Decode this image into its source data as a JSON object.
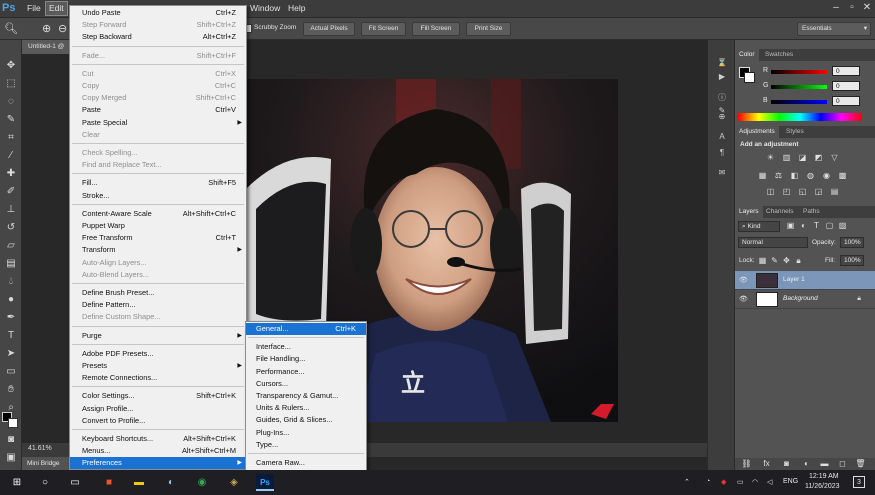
{
  "app": {
    "logo": "Ps",
    "document_tab": "Untitled-1 @",
    "zoom": "41.61%",
    "mini_bridge": "Mini Bridge"
  },
  "menubar": {
    "items": [
      "File",
      "Edit"
    ],
    "window": "Window",
    "help": "Help",
    "active": "Edit"
  },
  "options_bar": {
    "scrubby_zoom": "Scrubby Zoom",
    "actual_pixels": "Actual Pixels",
    "fit_screen": "Fit Screen",
    "fill_screen": "Fill Screen",
    "print_size": "Print Size",
    "workspace": "Essentials"
  },
  "edit_menu": [
    {
      "label": "Undo Paste",
      "shortcut": "Ctrl+Z",
      "enabled": true
    },
    {
      "label": "Step Forward",
      "shortcut": "Shift+Ctrl+Z",
      "enabled": false
    },
    {
      "label": "Step Backward",
      "shortcut": "Alt+Ctrl+Z",
      "enabled": true
    },
    {
      "sep": true
    },
    {
      "label": "Fade...",
      "shortcut": "Shift+Ctrl+F",
      "enabled": false
    },
    {
      "sep": true
    },
    {
      "label": "Cut",
      "shortcut": "Ctrl+X",
      "enabled": false
    },
    {
      "label": "Copy",
      "shortcut": "Ctrl+C",
      "enabled": false
    },
    {
      "label": "Copy Merged",
      "shortcut": "Shift+Ctrl+C",
      "enabled": false
    },
    {
      "label": "Paste",
      "shortcut": "Ctrl+V",
      "enabled": true
    },
    {
      "label": "Paste Special",
      "shortcut": "",
      "enabled": true,
      "submenu": true
    },
    {
      "label": "Clear",
      "shortcut": "",
      "enabled": false
    },
    {
      "sep": true
    },
    {
      "label": "Check Spelling...",
      "shortcut": "",
      "enabled": false
    },
    {
      "label": "Find and Replace Text...",
      "shortcut": "",
      "enabled": false
    },
    {
      "sep": true
    },
    {
      "label": "Fill...",
      "shortcut": "Shift+F5",
      "enabled": true
    },
    {
      "label": "Stroke...",
      "shortcut": "",
      "enabled": true
    },
    {
      "sep": true
    },
    {
      "label": "Content-Aware Scale",
      "shortcut": "Alt+Shift+Ctrl+C",
      "enabled": true
    },
    {
      "label": "Puppet Warp",
      "shortcut": "",
      "enabled": true
    },
    {
      "label": "Free Transform",
      "shortcut": "Ctrl+T",
      "enabled": true
    },
    {
      "label": "Transform",
      "shortcut": "",
      "enabled": true,
      "submenu": true
    },
    {
      "label": "Auto-Align Layers...",
      "shortcut": "",
      "enabled": false
    },
    {
      "label": "Auto-Blend Layers...",
      "shortcut": "",
      "enabled": false
    },
    {
      "sep": true
    },
    {
      "label": "Define Brush Preset...",
      "shortcut": "",
      "enabled": true
    },
    {
      "label": "Define Pattern...",
      "shortcut": "",
      "enabled": true
    },
    {
      "label": "Define Custom Shape...",
      "shortcut": "",
      "enabled": false
    },
    {
      "sep": true
    },
    {
      "label": "Purge",
      "shortcut": "",
      "enabled": true,
      "submenu": true
    },
    {
      "sep": true
    },
    {
      "label": "Adobe PDF Presets...",
      "shortcut": "",
      "enabled": true
    },
    {
      "label": "Presets",
      "shortcut": "",
      "enabled": true,
      "submenu": true
    },
    {
      "label": "Remote Connections...",
      "shortcut": "",
      "enabled": true
    },
    {
      "sep": true
    },
    {
      "label": "Color Settings...",
      "shortcut": "Shift+Ctrl+K",
      "enabled": true
    },
    {
      "label": "Assign Profile...",
      "shortcut": "",
      "enabled": true
    },
    {
      "label": "Convert to Profile...",
      "shortcut": "",
      "enabled": true
    },
    {
      "sep": true
    },
    {
      "label": "Keyboard Shortcuts...",
      "shortcut": "Alt+Shift+Ctrl+K",
      "enabled": true
    },
    {
      "label": "Menus...",
      "shortcut": "Alt+Shift+Ctrl+M",
      "enabled": true
    },
    {
      "label": "Preferences",
      "shortcut": "",
      "enabled": true,
      "submenu": true,
      "highlighted": true
    }
  ],
  "preferences_submenu": [
    {
      "label": "General...",
      "shortcut": "Ctrl+K",
      "highlighted": true
    },
    {
      "sep": true
    },
    {
      "label": "Interface..."
    },
    {
      "label": "File Handling..."
    },
    {
      "label": "Performance..."
    },
    {
      "label": "Cursors..."
    },
    {
      "label": "Transparency & Gamut..."
    },
    {
      "label": "Units & Rulers..."
    },
    {
      "label": "Guides, Grid & Slices..."
    },
    {
      "label": "Plug-Ins..."
    },
    {
      "label": "Type..."
    },
    {
      "sep": true
    },
    {
      "label": "Camera Raw..."
    }
  ],
  "color_panel": {
    "tabs": [
      "Color",
      "Swatches"
    ],
    "r_label": "R",
    "g_label": "G",
    "b_label": "B",
    "r": "0",
    "g": "0",
    "b": "0"
  },
  "adjustments_panel": {
    "tabs": [
      "Adjustments",
      "Styles"
    ],
    "heading": "Add an adjustment"
  },
  "layers_panel": {
    "tabs": [
      "Layers",
      "Channels",
      "Paths"
    ],
    "kind": "Kind",
    "blend_mode": "Normal",
    "opacity_label": "Opacity:",
    "opacity": "100%",
    "lock_label": "Lock:",
    "fill_label": "Fill:",
    "fill": "100%",
    "layers": [
      {
        "name": "Layer 1",
        "selected": true
      },
      {
        "name": "Background",
        "selected": false
      }
    ]
  },
  "taskbar": {
    "language": "ENG",
    "time": "12:19 AM",
    "date": "11/26/2023",
    "notifications": "3"
  },
  "colors": {
    "menu_highlight": "#1a73d2",
    "layer_selected": "#7b96b8",
    "panel_bg": "#535353"
  }
}
